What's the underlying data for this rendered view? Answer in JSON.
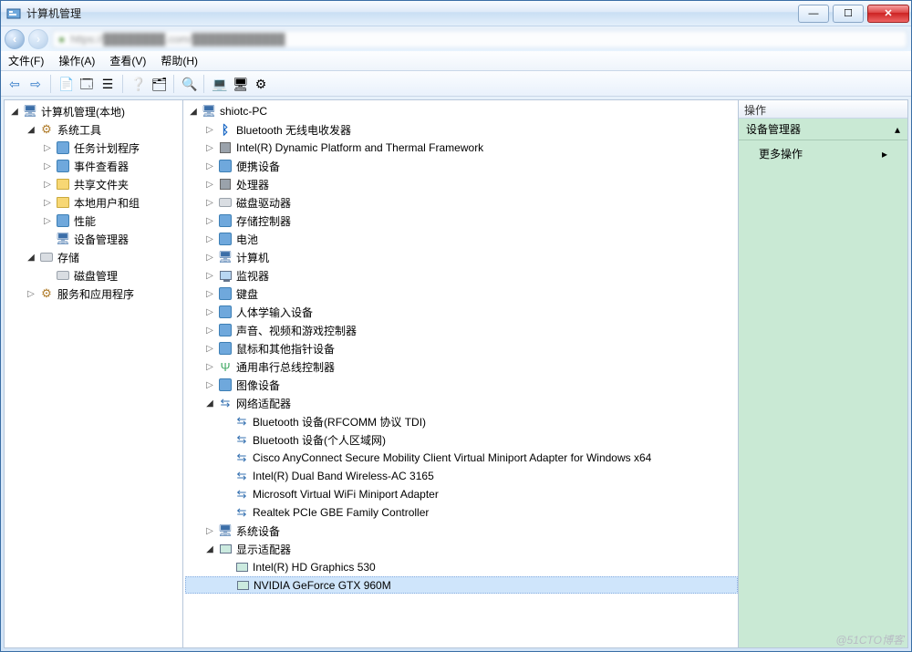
{
  "window": {
    "title": "计算机管理"
  },
  "menu": {
    "file": "文件(F)",
    "action": "操作(A)",
    "view": "查看(V)",
    "help": "帮助(H)"
  },
  "left_tree": {
    "root": "计算机管理(本地)",
    "systools": "系统工具",
    "systools_children": [
      "任务计划程序",
      "事件查看器",
      "共享文件夹",
      "本地用户和组",
      "性能",
      "设备管理器"
    ],
    "storage": "存储",
    "storage_children": [
      "磁盘管理"
    ],
    "services": "服务和应用程序"
  },
  "device_tree": {
    "root": "shiotc-PC",
    "items": [
      {
        "label": "Bluetooth 无线电收发器",
        "icon": "bt"
      },
      {
        "label": "Intel(R) Dynamic Platform and Thermal Framework",
        "icon": "cpu"
      },
      {
        "label": "便携设备",
        "icon": "generic"
      },
      {
        "label": "处理器",
        "icon": "cpu"
      },
      {
        "label": "磁盘驱动器",
        "icon": "disk"
      },
      {
        "label": "存储控制器",
        "icon": "generic"
      },
      {
        "label": "电池",
        "icon": "generic"
      },
      {
        "label": "计算机",
        "icon": "pc"
      },
      {
        "label": "监视器",
        "icon": "mon"
      },
      {
        "label": "键盘",
        "icon": "generic"
      },
      {
        "label": "人体学输入设备",
        "icon": "generic"
      },
      {
        "label": "声音、视频和游戏控制器",
        "icon": "generic"
      },
      {
        "label": "鼠标和其他指针设备",
        "icon": "generic"
      },
      {
        "label": "通用串行总线控制器",
        "icon": "usb"
      },
      {
        "label": "图像设备",
        "icon": "generic"
      }
    ],
    "network": {
      "label": "网络适配器",
      "children": [
        "Bluetooth 设备(RFCOMM 协议 TDI)",
        "Bluetooth 设备(个人区域网)",
        "Cisco AnyConnect Secure Mobility Client Virtual Miniport Adapter for Windows x64",
        "Intel(R) Dual Band Wireless-AC 3165",
        "Microsoft Virtual WiFi Miniport Adapter",
        "Realtek PCIe GBE Family Controller"
      ]
    },
    "sysdev": "系统设备",
    "display": {
      "label": "显示适配器",
      "children": [
        "Intel(R) HD Graphics 530",
        "NVIDIA GeForce GTX 960M"
      ],
      "selected": 1
    }
  },
  "right": {
    "header": "操作",
    "section": "设备管理器",
    "more": "更多操作"
  },
  "watermark": "@51CTO博客"
}
